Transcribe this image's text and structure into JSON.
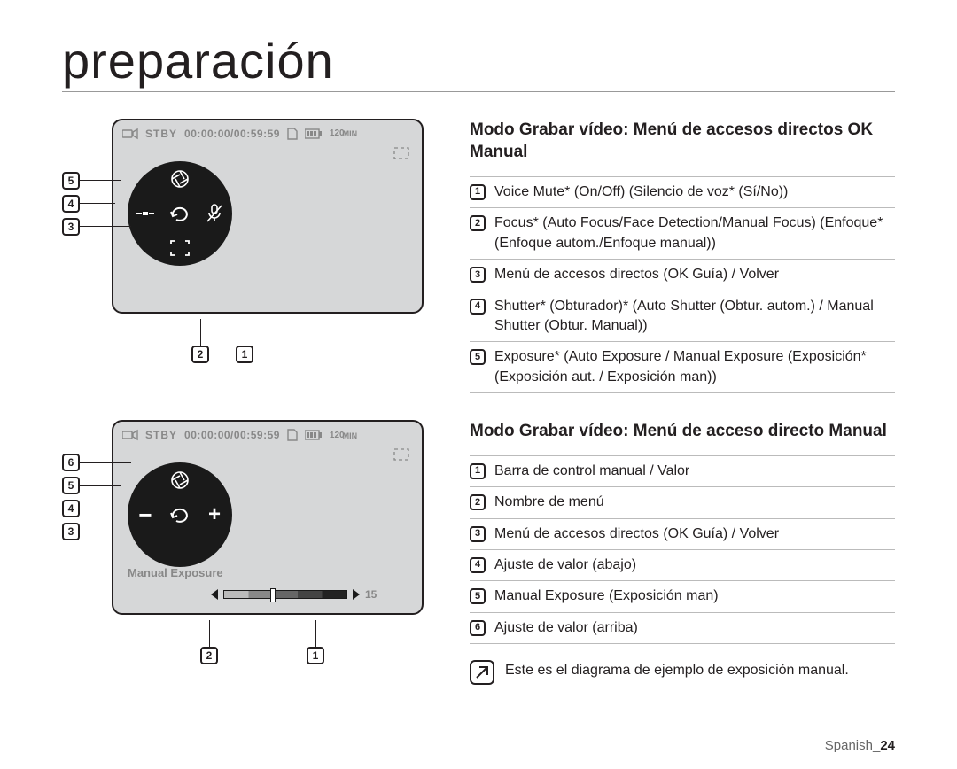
{
  "page_title": "preparación",
  "footer_lang": "Spanish",
  "footer_page": "24",
  "screen": {
    "stby": "STBY",
    "timecode": "00:00:00/00:59:59",
    "minutes_badge": "120",
    "minutes_unit": "MIN",
    "manual_exposure_label": "Manual Exposure",
    "slider_value": "15"
  },
  "section1": {
    "heading": "Modo Grabar vídeo: Menú de accesos directos OK Manual",
    "callout_left": [
      "5",
      "4",
      "3"
    ],
    "callout_bottom": [
      "2",
      "1"
    ],
    "dial": {
      "top": "aperture",
      "right": "mic-off",
      "bottom": "focus",
      "left": "shutter",
      "center": "back"
    },
    "items": [
      {
        "n": "1",
        "t": "Voice Mute* (On/Off) (Silencio de voz* (Sí/No))"
      },
      {
        "n": "2",
        "t": "Focus* (Auto Focus/Face Detection/Manual Focus) (Enfoque* (Enfoque autom./Enfoque manual))"
      },
      {
        "n": "3",
        "t": "Menú de accesos directos (OK Guía) / Volver"
      },
      {
        "n": "4",
        "t": "Shutter* (Obturador)* (Auto Shutter (Obtur. autom.) / Manual Shutter (Obtur. Manual))"
      },
      {
        "n": "5",
        "t": "Exposure* (Auto Exposure / Manual Exposure (Exposición* (Exposición aut. / Exposición man))"
      }
    ]
  },
  "section2": {
    "heading": "Modo Grabar vídeo: Menú de acceso directo Manual",
    "callout_left": [
      "6",
      "5",
      "4",
      "3"
    ],
    "callout_bottom": [
      "2",
      "1"
    ],
    "dial": {
      "top": "aperture",
      "right": "plus",
      "bottom": "",
      "left": "minus",
      "center": "back"
    },
    "items": [
      {
        "n": "1",
        "t": "Barra de control manual / Valor"
      },
      {
        "n": "2",
        "t": "Nombre de menú"
      },
      {
        "n": "3",
        "t": "Menú de accesos directos (OK Guía) / Volver"
      },
      {
        "n": "4",
        "t": "Ajuste de valor (abajo)"
      },
      {
        "n": "5",
        "t": "Manual Exposure (Exposición man)"
      },
      {
        "n": "6",
        "t": "Ajuste de valor (arriba)"
      }
    ],
    "note": "Este es el diagrama de ejemplo de exposición manual."
  }
}
